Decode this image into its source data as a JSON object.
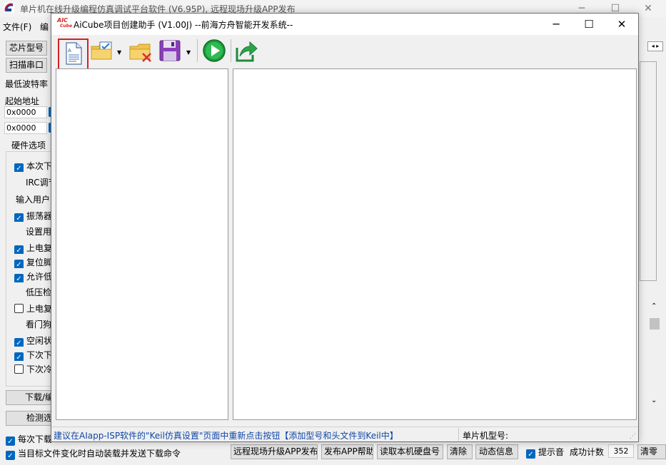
{
  "background": {
    "title": "单片机在线升级编程仿真调试平台软件 (V6.95P), 远程现场升级APP发布",
    "menus": [
      "文件(F)",
      "编"
    ],
    "buttons": {
      "chip_model": "芯片型号",
      "scan_port": "扫描串口"
    },
    "min_baud_label": "最低波特率",
    "start_addr_label": "起始地址",
    "addr1": "0x0000",
    "addr2": "0x0000",
    "hw_options_title": "硬件选项",
    "options": [
      {
        "label": "本次下",
        "checked": true
      },
      {
        "label": "IRC调节",
        "checked": null
      },
      {
        "label": "输入用户",
        "checked": null
      },
      {
        "label": "振荡器",
        "checked": true
      },
      {
        "label": "设置用",
        "checked": null
      },
      {
        "label": "上电复",
        "checked": true
      },
      {
        "label": "复位脚",
        "checked": true
      },
      {
        "label": "允许低",
        "checked": true
      },
      {
        "label": "低压检",
        "checked": null
      },
      {
        "label": "上电复",
        "checked": false
      },
      {
        "label": "看门狗",
        "checked": null
      },
      {
        "label": "空闲状",
        "checked": true
      },
      {
        "label": "下次下",
        "checked": true
      },
      {
        "label": "下次冷",
        "checked": false
      }
    ],
    "download_button": "下载/编",
    "detect_button": "检测选",
    "check_reload": "每次下载前都重新装载目标文件",
    "check_auto": "当目标文件变化时自动装载并发送下载命令",
    "bottom_buttons": [
      "远程现场升级APP发布",
      "发布APP帮助",
      "读取本机硬盘号",
      "清除",
      "动态信息"
    ],
    "prompt_sound": "提示音",
    "success_count_label": "成功计数",
    "success_count": "352",
    "clear_zero": "清零"
  },
  "dialog": {
    "title": "AiCube项目创建助手 (V1.00J) --前海方舟智能开发系统--",
    "logo_text_top": "AIC",
    "logo_text_bottom": "Cube",
    "toolbar": [
      {
        "name": "new-project",
        "icon": "new-document-icon"
      },
      {
        "name": "open-project",
        "icon": "folder-check-icon"
      },
      {
        "name": "close-project",
        "icon": "folder-delete-icon"
      },
      {
        "name": "save-project",
        "icon": "floppy-disk-icon"
      },
      {
        "name": "run",
        "icon": "play-icon"
      },
      {
        "name": "export",
        "icon": "share-arrow-icon"
      }
    ],
    "status_message": "建议在AIapp-ISP软件的\"Keil仿真设置\"页面中重新点击按钮【添加型号和头文件到Keil中】",
    "chip_model_label": "单片机型号:"
  }
}
